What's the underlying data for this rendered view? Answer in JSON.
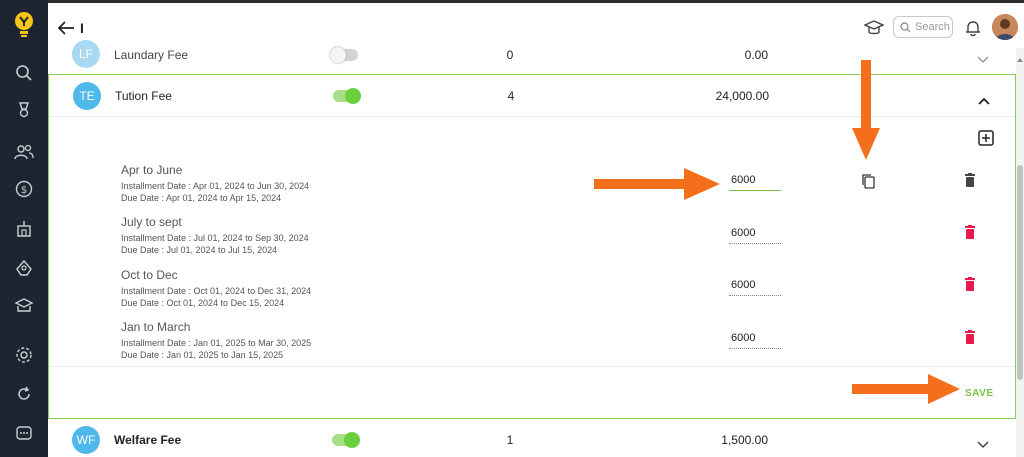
{
  "header": {
    "title": "I",
    "search_placeholder": "Search"
  },
  "sidebar": {
    "icons": [
      "logo-icon",
      "search-icon",
      "trophy-icon",
      "people-icon",
      "dollar-icon",
      "building-icon",
      "network-icon",
      "school-icon",
      "settings-icon",
      "refresh-icon",
      "chat-icon"
    ]
  },
  "fees": [
    {
      "badge": "LF",
      "name": "Laundary Fee",
      "enabled": false,
      "count": "0",
      "amount": "0.00",
      "badge_color": "#a9d8f2"
    },
    {
      "badge": "TE",
      "name": "Tution Fee",
      "enabled": true,
      "count": "4",
      "amount": "24,000.00",
      "badge_color": "#4fb8ea"
    },
    {
      "badge": "WF",
      "name": "Welfare Fee",
      "enabled": true,
      "count": "1",
      "amount": "1,500.00",
      "badge_color": "#4fb8ea"
    }
  ],
  "installments": [
    {
      "title": "Apr to June",
      "installment_date": "Installment Date : Apr 01, 2024 to Jun 30, 2024",
      "due_date": "Due Date : Apr 01, 2024 to Apr 15, 2024",
      "amount": "6000"
    },
    {
      "title": "July to sept",
      "installment_date": "Installment Date : Jul 01, 2024 to Sep 30, 2024",
      "due_date": "Due Date : Jul 01, 2024 to Jul 15, 2024",
      "amount": "6000"
    },
    {
      "title": "Oct to Dec",
      "installment_date": "Installment Date : Oct 01, 2024 to Dec 31, 2024",
      "due_date": "Due Date : Oct 01, 2024 to Dec 15, 2024",
      "amount": "6000"
    },
    {
      "title": "Jan to March",
      "installment_date": "Installment Date : Jan 01, 2025 to Mar 30, 2025",
      "due_date": "Due Date : Jan 01, 2025 to Jan 15, 2025",
      "amount": "6000"
    }
  ],
  "save_label": "SAVE",
  "colors": {
    "accent_green": "#7cc242",
    "toggle_green": "#6ccf3c",
    "delete_red": "#e8194d",
    "annotation_orange": "#f36f1b",
    "sidebar_bg": "#1e2530"
  }
}
